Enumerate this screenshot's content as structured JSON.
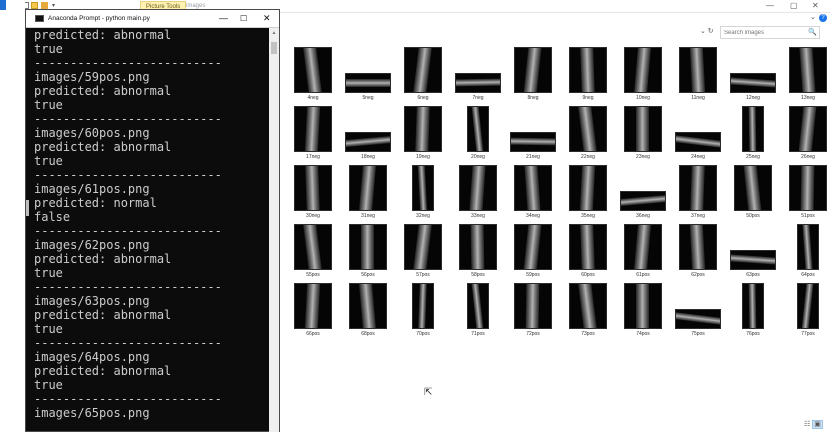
{
  "explorer": {
    "ribbon": {
      "picture_tools_label": "Picture Tools",
      "title": "images"
    },
    "window_controls": {
      "minimize": "—",
      "maximize": "▢",
      "close": "✕",
      "help": "?",
      "collapse_ribbon": "⌄"
    },
    "address_controls": "⌄ ↻",
    "search": {
      "placeholder": "Search images",
      "icon": "🔍"
    },
    "thumbnails": [
      {
        "name": "4neg"
      },
      {
        "name": "5neg"
      },
      {
        "name": "6neg"
      },
      {
        "name": "7neg"
      },
      {
        "name": "8neg"
      },
      {
        "name": "9neg"
      },
      {
        "name": "10neg"
      },
      {
        "name": "11neg"
      },
      {
        "name": "12neg"
      },
      {
        "name": "13neg"
      },
      {
        "name": "17neg"
      },
      {
        "name": "18neg"
      },
      {
        "name": "19neg"
      },
      {
        "name": "20neg"
      },
      {
        "name": "21neg"
      },
      {
        "name": "22neg"
      },
      {
        "name": "23neg"
      },
      {
        "name": "24neg"
      },
      {
        "name": "25neg"
      },
      {
        "name": "26neg"
      },
      {
        "name": "30neg"
      },
      {
        "name": "31neg"
      },
      {
        "name": "32neg"
      },
      {
        "name": "33neg"
      },
      {
        "name": "34neg"
      },
      {
        "name": "35neg"
      },
      {
        "name": "36neg"
      },
      {
        "name": "37neg"
      },
      {
        "name": "50pos"
      },
      {
        "name": "51pos"
      },
      {
        "name": "55pos"
      },
      {
        "name": "56pos"
      },
      {
        "name": "57pos"
      },
      {
        "name": "58pos"
      },
      {
        "name": "59pos"
      },
      {
        "name": "60pos"
      },
      {
        "name": "61pos"
      },
      {
        "name": "62pos"
      },
      {
        "name": "63pos"
      },
      {
        "name": "64pos"
      },
      {
        "name": "66pos"
      },
      {
        "name": "68pos"
      },
      {
        "name": "70pos"
      },
      {
        "name": "71pos"
      },
      {
        "name": "72pos"
      },
      {
        "name": "73pos"
      },
      {
        "name": "74pos"
      },
      {
        "name": "75pos"
      },
      {
        "name": "76pos"
      },
      {
        "name": "77pos"
      }
    ],
    "view_icons": {
      "details": "☷",
      "large": "▣"
    },
    "cursor": "⇱"
  },
  "cmd": {
    "title": "Anaconda Prompt - python  main.py",
    "controls": {
      "minimize": "—",
      "maximize": "☐",
      "close": "✕"
    },
    "scroll_up": "▲",
    "lines": [
      "predicted: abnormal",
      "true",
      "--------------------------",
      "images/59pos.png",
      "predicted: abnormal",
      "true",
      "--------------------------",
      "images/60pos.png",
      "predicted: abnormal",
      "true",
      "--------------------------",
      "images/61pos.png",
      "predicted: normal",
      "false",
      "--------------------------",
      "images/62pos.png",
      "predicted: abnormal",
      "true",
      "--------------------------",
      "images/63pos.png",
      "predicted: abnormal",
      "true",
      "--------------------------",
      "images/64pos.png",
      "predicted: abnormal",
      "true",
      "--------------------------",
      "images/65pos.png"
    ]
  }
}
